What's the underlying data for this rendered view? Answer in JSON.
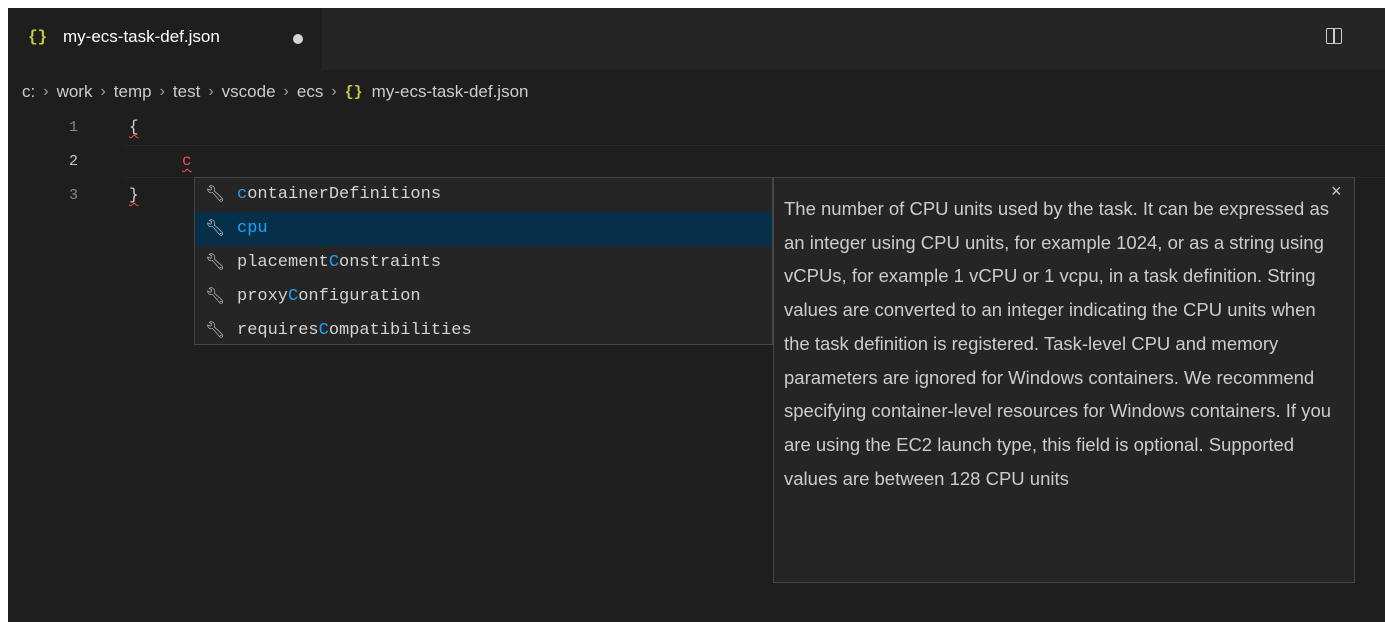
{
  "tab": {
    "icon": "json-braces-icon",
    "icon_glyph": "{}",
    "title": "my-ecs-task-def.json",
    "dirty": true
  },
  "breadcrumb": {
    "segments": [
      "c:",
      "work",
      "temp",
      "test",
      "vscode",
      "ecs"
    ],
    "file_icon_glyph": "{}",
    "file": "my-ecs-task-def.json",
    "separator": "›"
  },
  "lines": [
    {
      "number": "1",
      "text": "{"
    },
    {
      "number": "2",
      "text": "c"
    },
    {
      "number": "3",
      "text": "}"
    }
  ],
  "suggestions": [
    {
      "prefix": "",
      "match": "c",
      "rest": "ontainerDefinitions",
      "selected": false,
      "icon": "wrench-icon"
    },
    {
      "prefix": "",
      "match": "c",
      "rest": "pu",
      "selected": true,
      "icon": "wrench-icon"
    },
    {
      "prefix": "placement",
      "match": "C",
      "rest": "onstraints",
      "selected": false,
      "icon": "wrench-icon"
    },
    {
      "prefix": "proxy",
      "match": "C",
      "rest": "onfiguration",
      "selected": false,
      "icon": "wrench-icon"
    },
    {
      "prefix": "requires",
      "match": "C",
      "rest": "ompatibilities",
      "selected": false,
      "icon": "wrench-icon"
    }
  ],
  "details": {
    "text": "The number of CPU units used by the task. It can be expressed as an integer using CPU units, for example 1024, or as a string using vCPUs, for example 1 vCPU or 1 vcpu, in a task definition. String values are converted to an integer indicating the CPU units when the task definition is registered.  Task-level CPU and memory parameters are ignored for Windows containers. We recommend specifying container-level resources for Windows containers.  If you are using the EC2 launch type, this field is optional. Supported values are between 128 CPU units",
    "close_glyph": "×"
  },
  "colors": {
    "editor_bg": "#1e1e1e",
    "tabbar_bg": "#252526",
    "json_icon": "#cbcb41",
    "match_highlight": "#18a3ff",
    "selected_bg": "#062f4a",
    "error_squiggle": "#f14c4c"
  }
}
